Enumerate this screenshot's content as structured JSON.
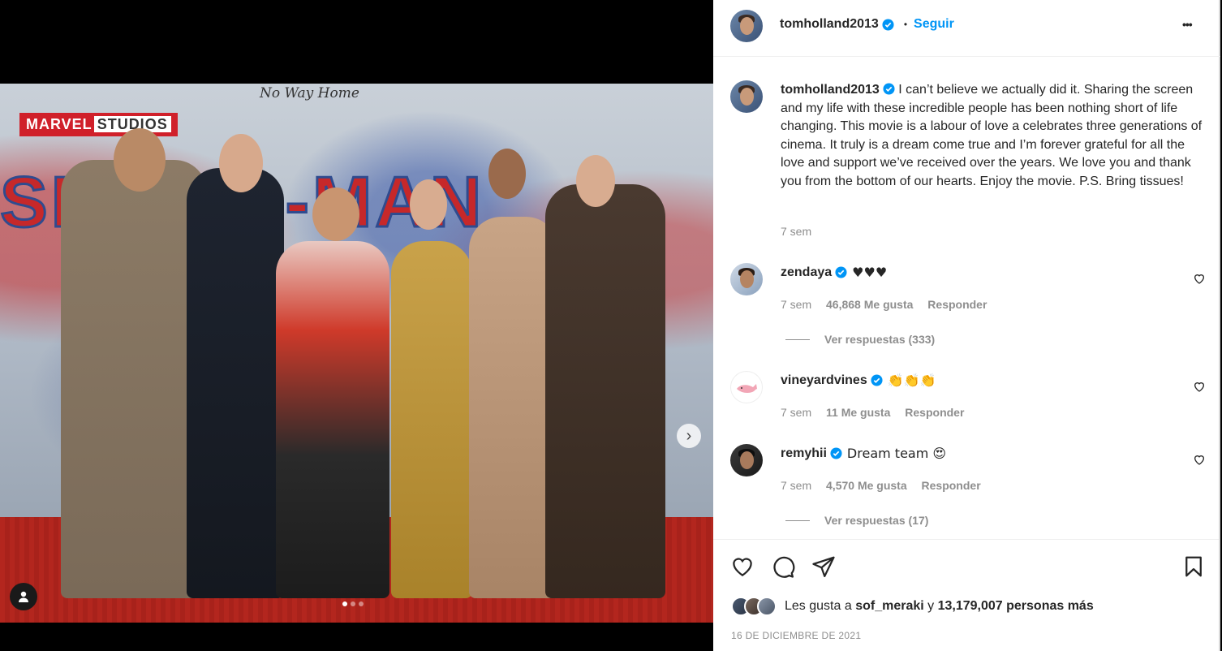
{
  "post": {
    "author": "tomholland2013",
    "follow_label": "Seguir",
    "separator": "•",
    "more_label": "•••",
    "caption": "I can’t believe we actually did it. Sharing the screen and my life with these incredible people has been nothing short of life changing. This movie is a labour of love a celebrates three generations of cinema. It truly is a dream come true and I’m forever grateful for all the love and support we’ve received over the years. We love you and thank you from the bottom of our hearts. Enjoy the movie. P.S. Bring tissues!",
    "caption_time": "7 sem"
  },
  "media": {
    "brand_text_1": "MARVEL",
    "brand_text_2": "STUDIOS",
    "tagline": "No Way Home",
    "title_text": "SPIDER-MAN",
    "carousel_total": 3,
    "carousel_active": 1,
    "next_label": "›"
  },
  "comments": [
    {
      "user": "zendaya",
      "text": "♥♥♥",
      "time": "7 sem",
      "likes": "46,868 Me gusta",
      "reply": "Responder",
      "view_replies": "Ver respuestas (333)"
    },
    {
      "user": "vineyardvines",
      "text": "👏👏👏",
      "time": "7 sem",
      "likes": "11 Me gusta",
      "reply": "Responder",
      "view_replies": ""
    },
    {
      "user": "remyhii",
      "text": "Dream team 😍",
      "time": "7 sem",
      "likes": "4,570 Me gusta",
      "reply": "Responder",
      "view_replies": "Ver respuestas (17)"
    }
  ],
  "footer": {
    "likes_prefix": "Les gusta a",
    "likes_user": "sof_meraki",
    "likes_middle": "y",
    "likes_count": "13,179,007 personas más",
    "date": "16 DE DICIEMBRE DE 2021"
  },
  "icons": {
    "verified": "verified-badge-icon",
    "like": "heart-icon",
    "comment": "comment-icon",
    "share": "paper-plane-icon",
    "save": "bookmark-icon",
    "tag": "user-tag-icon",
    "next": "chevron-right-icon"
  },
  "colors": {
    "accent": "#0095f6",
    "text": "#262626",
    "muted": "#8e8e8e",
    "border": "#efefef"
  }
}
